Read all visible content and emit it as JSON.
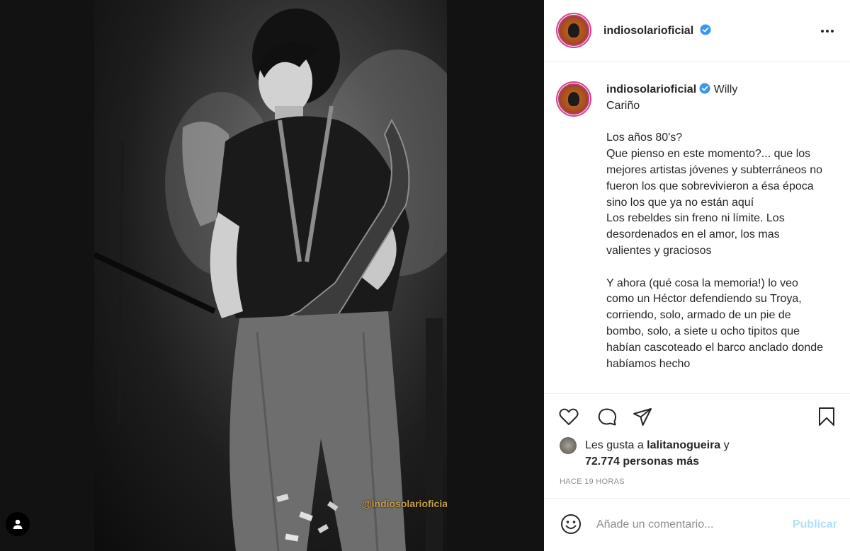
{
  "account": {
    "username": "indiosolarioficial"
  },
  "photo": {
    "watermark_text": "@indiosolarioficial"
  },
  "caption": {
    "username": "indiosolarioficial",
    "text": "Willy\nCariño\n\nLos años 80's?\nQue pienso en este momento?... que los mejores artistas jóvenes y subterráneos no fueron los que sobrevivieron a ésa época sino los que ya no están aquí\nLos rebeldes sin freno ni límite. Los desordenados en el amor, los mas valientes y graciosos\n\nY ahora (qué cosa la memoria!) lo veo como un Héctor defendiendo su Troya, corriendo, solo, armado de un pie de bombo, solo, a siete u ocho tipitos que habían cascoteado el barco anclado donde habíamos hecho"
  },
  "likes": {
    "prefix": "Les gusta a ",
    "liker": "lalitanogueira",
    "middle": " y",
    "count_text": "72.774 personas más"
  },
  "timestamp": "HACE 19 HORAS",
  "comment": {
    "placeholder": "Añade un comentario...",
    "post_label": "Publicar"
  },
  "icons": {
    "like": "heart-icon",
    "comment": "comment-icon",
    "share": "share-icon",
    "save": "bookmark-icon",
    "more": "more-options-icon",
    "emoji": "emoji-icon",
    "tag": "user-tag-icon",
    "verified": "verified-badge-icon"
  },
  "colors": {
    "verified": "#3897f0",
    "post_button": "#b2dffc",
    "watermark": "#c8a04a"
  }
}
